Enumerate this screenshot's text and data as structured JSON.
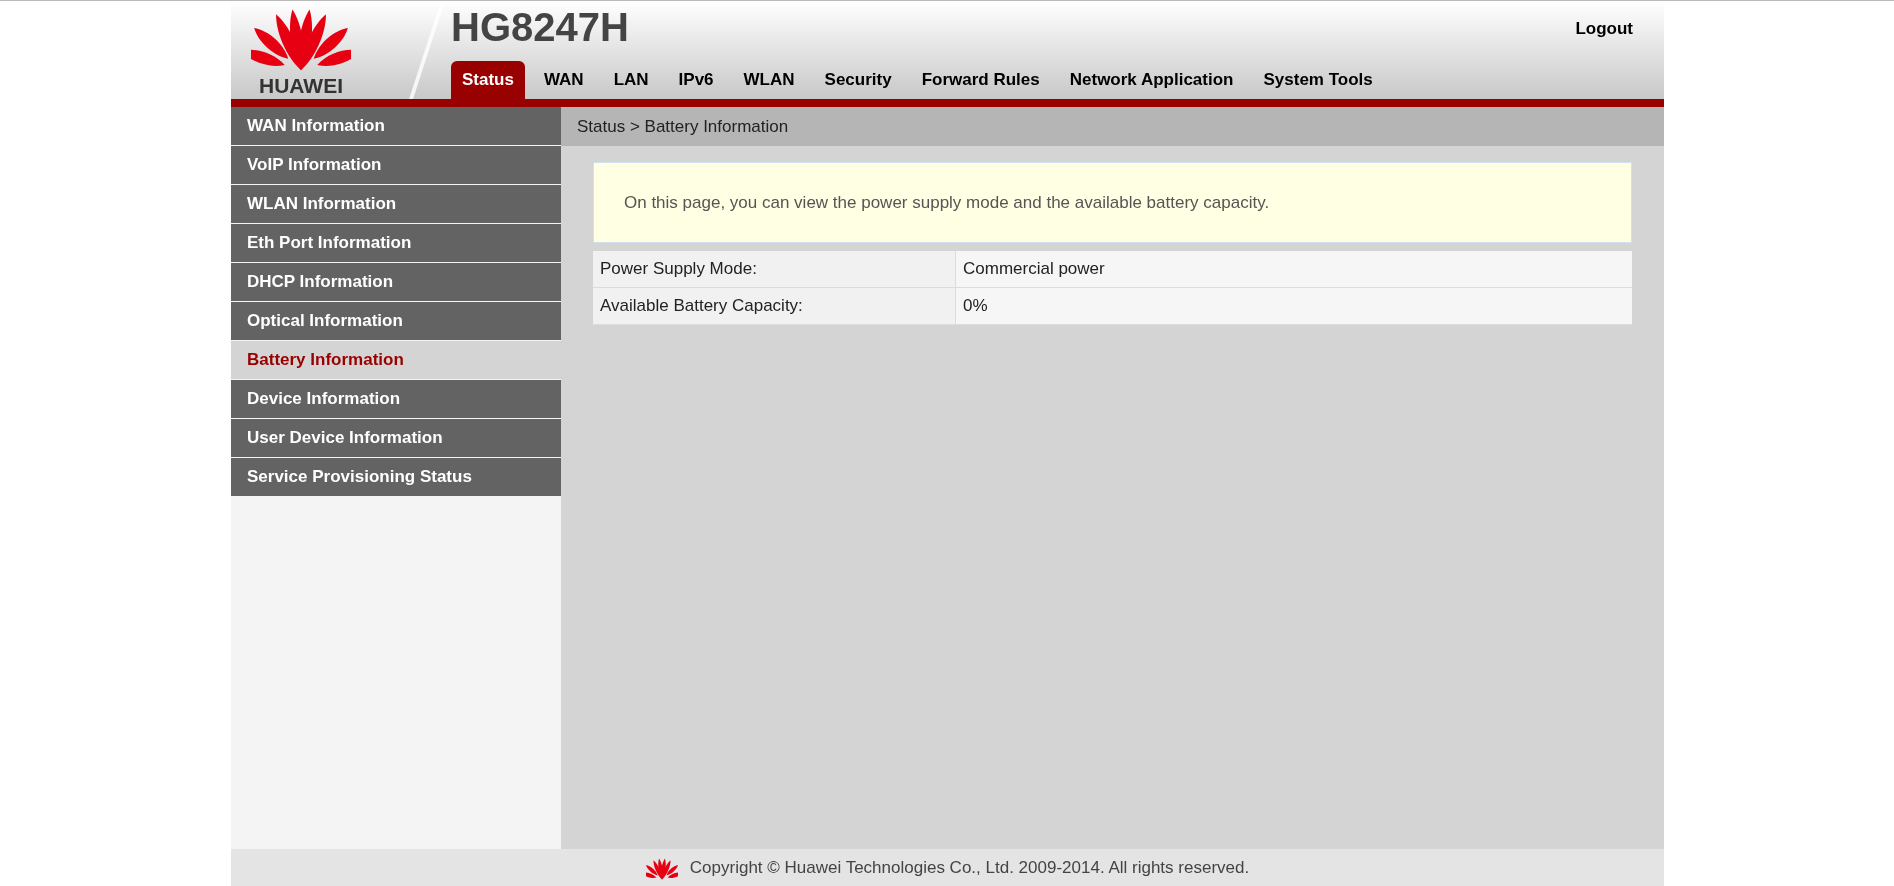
{
  "header": {
    "brand": "HUAWEI",
    "model": "HG8247H",
    "logout": "Logout"
  },
  "tabs": [
    {
      "label": "Status",
      "selected": true
    },
    {
      "label": "WAN",
      "selected": false
    },
    {
      "label": "LAN",
      "selected": false
    },
    {
      "label": "IPv6",
      "selected": false
    },
    {
      "label": "WLAN",
      "selected": false
    },
    {
      "label": "Security",
      "selected": false
    },
    {
      "label": "Forward Rules",
      "selected": false
    },
    {
      "label": "Network Application",
      "selected": false
    },
    {
      "label": "System Tools",
      "selected": false
    }
  ],
  "sidebar": {
    "items": [
      {
        "label": "WAN Information",
        "selected": false
      },
      {
        "label": "VoIP Information",
        "selected": false
      },
      {
        "label": "WLAN Information",
        "selected": false
      },
      {
        "label": "Eth Port Information",
        "selected": false
      },
      {
        "label": "DHCP Information",
        "selected": false
      },
      {
        "label": "Optical Information",
        "selected": false
      },
      {
        "label": "Battery Information",
        "selected": true
      },
      {
        "label": "Device Information",
        "selected": false
      },
      {
        "label": "User Device Information",
        "selected": false
      },
      {
        "label": "Service Provisioning Status",
        "selected": false
      }
    ]
  },
  "breadcrumb": "Status > Battery Information",
  "notice": "On this page, you can view the power supply mode and the available battery capacity.",
  "table": {
    "rows": [
      {
        "label": "Power Supply Mode:",
        "value": "Commercial power"
      },
      {
        "label": "Available Battery Capacity:",
        "value": "0%"
      }
    ]
  },
  "footer": "Copyright © Huawei Technologies Co., Ltd. 2009-2014. All rights reserved."
}
